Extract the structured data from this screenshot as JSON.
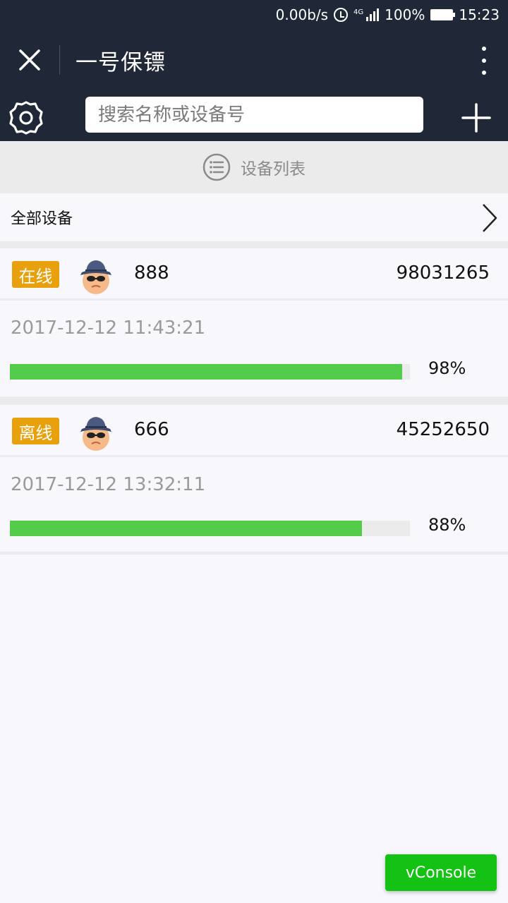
{
  "status_bar": {
    "net_speed": "0.00b/s",
    "network": "4G",
    "battery": "100%",
    "time": "15:23"
  },
  "header": {
    "title": "一号保镖",
    "close_icon": "close-icon",
    "more_icon": "more-vertical-icon"
  },
  "search": {
    "placeholder": "搜索名称或设备号",
    "settings_icon": "gear-icon",
    "add_icon": "plus-icon"
  },
  "section": {
    "label": "设备列表",
    "icon": "list-icon"
  },
  "all_devices": {
    "label": "全部设备",
    "icon": "chevron-right-icon"
  },
  "devices": [
    {
      "status": "在线",
      "name": "888",
      "id": "98031265",
      "time": "2017-12-12 11:43:21",
      "battery_percent": 98,
      "battery_label": "98%"
    },
    {
      "status": "离线",
      "name": "666",
      "id": "45252650",
      "time": "2017-12-12 13:32:11",
      "battery_percent": 88,
      "battery_label": "88%"
    }
  ],
  "colors": {
    "header_bg": "#202838",
    "badge": "#e8a00c",
    "progress": "#53cb4b",
    "vconsole": "#13c213"
  },
  "vconsole": {
    "label": "vConsole"
  }
}
